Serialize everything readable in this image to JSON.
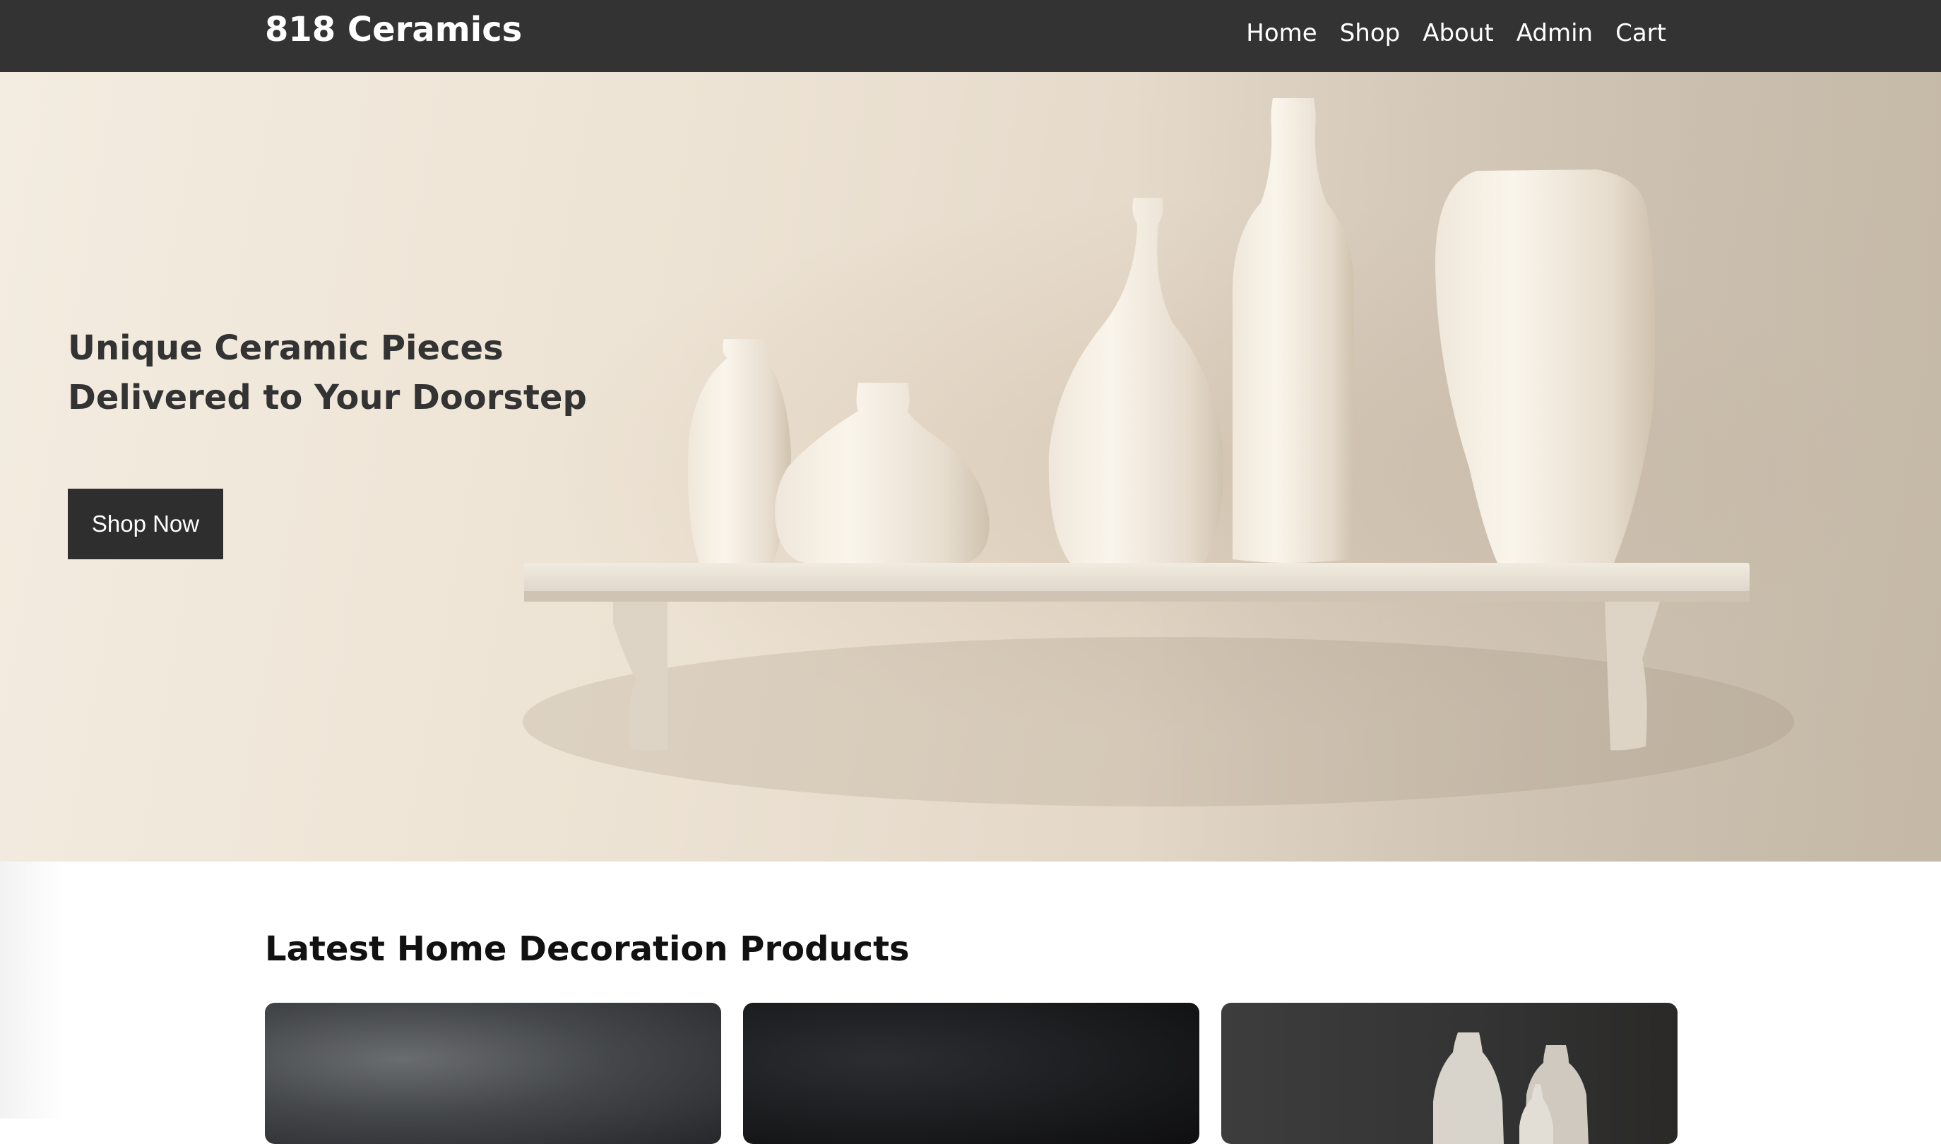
{
  "brand": {
    "name": "818 Ceramics"
  },
  "nav": {
    "links": [
      "Home",
      "Shop",
      "About",
      "Admin",
      "Cart"
    ]
  },
  "hero": {
    "title_line1": "Unique Ceramic Pieces",
    "title_line2": "Delivered to Your Doorstep",
    "cta_label": "Shop Now"
  },
  "products": {
    "section_title": "Latest Home Decoration Products"
  },
  "colors": {
    "navbar": "#333333",
    "button": "#2e2e2e",
    "hero_wall": "#ede3d4",
    "vase": "#f3ece0"
  }
}
